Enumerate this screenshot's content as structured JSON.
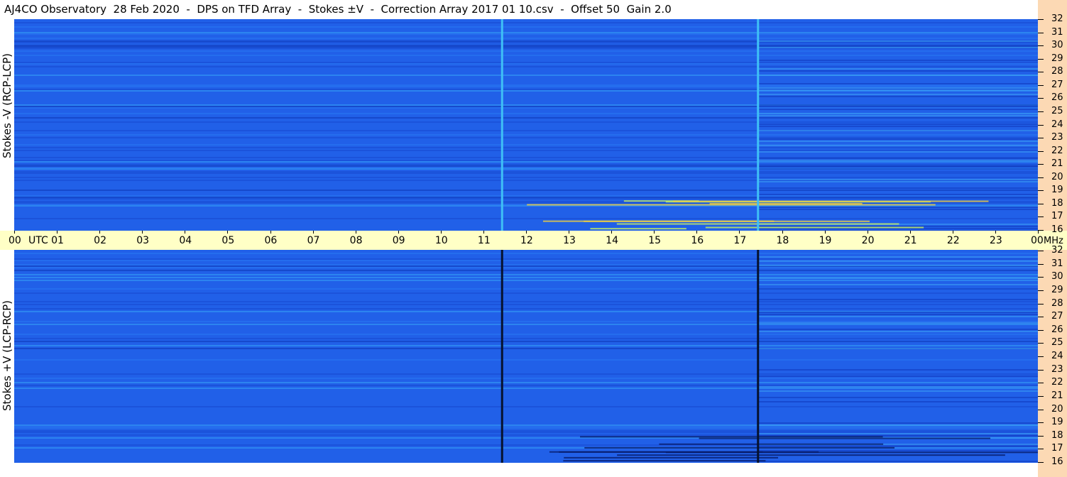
{
  "title": "AJ4CO Observatory  28 Feb 2020  -  DPS on TFD Array  -  Stokes ±V  -  Correction Array 2017 01 10.csv  -  Offset 50  Gain 2.0",
  "colors": {
    "background_blue": "#2160e8",
    "bright_band": "#3fb6f5",
    "dark_band": "#0a2fa8",
    "axis_band": "#ffffc6",
    "freq_band": "#fcd9b4"
  },
  "chart_data": [
    {
      "type": "heatmap",
      "panel": "top",
      "ylabel": "Stokes -V (RCP-LCP)",
      "x_ticks": [
        "00",
        "01",
        "02",
        "03",
        "04",
        "05",
        "06",
        "07",
        "08",
        "09",
        "10",
        "11",
        "12",
        "13",
        "14",
        "15",
        "16",
        "17",
        "18",
        "19",
        "20",
        "21",
        "22",
        "23",
        "00"
      ],
      "x_unit": "UTC",
      "y_ticks": [
        16,
        17,
        18,
        19,
        20,
        21,
        22,
        23,
        24,
        25,
        26,
        27,
        28,
        29,
        30,
        31,
        32
      ],
      "y_unit": "MHz",
      "ylim": [
        16,
        32
      ],
      "xlim_hours": [
        0,
        24
      ],
      "vertical_markers_utc": [
        11.43,
        17.43
      ],
      "marker_style": "bright"
    },
    {
      "type": "heatmap",
      "panel": "bottom",
      "ylabel": "Stokes +V (LCP-RCP)",
      "x_ticks": [
        "00",
        "01",
        "02",
        "03",
        "04",
        "05",
        "06",
        "07",
        "08",
        "09",
        "10",
        "11",
        "12",
        "13",
        "14",
        "15",
        "16",
        "17",
        "18",
        "19",
        "20",
        "21",
        "22",
        "23",
        "00"
      ],
      "x_unit": "UTC",
      "y_ticks": [
        16,
        17,
        18,
        19,
        20,
        21,
        22,
        23,
        24,
        25,
        26,
        27,
        28,
        29,
        30,
        31,
        32
      ],
      "y_unit": "MHz",
      "ylim": [
        16,
        32
      ],
      "xlim_hours": [
        0,
        24
      ],
      "vertical_markers_utc": [
        11.43,
        17.43
      ],
      "marker_style": "dark"
    }
  ]
}
